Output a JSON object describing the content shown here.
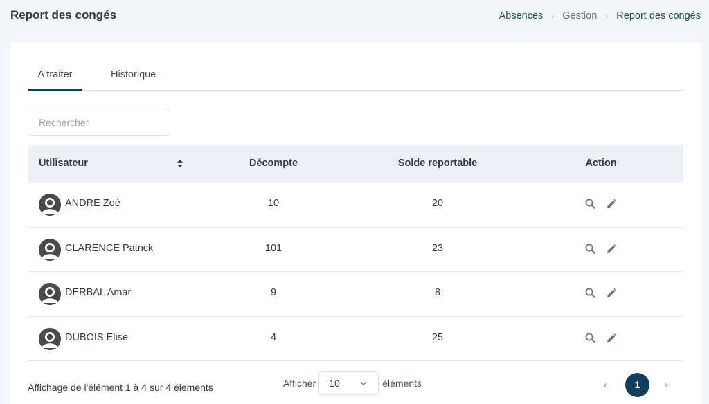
{
  "header": {
    "title": "Report des congés",
    "breadcrumb": [
      "Absences",
      "Gestion",
      "Report des congés"
    ]
  },
  "tabs": [
    {
      "label": "A traiter",
      "active": true
    },
    {
      "label": "Historique",
      "active": false
    }
  ],
  "search": {
    "placeholder": "Rechercher",
    "value": ""
  },
  "table": {
    "headers": [
      "Utilisateur",
      "Décompte",
      "Solde reportable",
      "Action"
    ],
    "rows": [
      {
        "user": "ANDRE Zoé",
        "decompte": "10",
        "solde": "20"
      },
      {
        "user": "CLARENCE Patrick",
        "decompte": "101",
        "solde": "23"
      },
      {
        "user": "DERBAL Amar",
        "decompte": "9",
        "solde": "8"
      },
      {
        "user": "DUBOIS Elise",
        "decompte": "4",
        "solde": "25"
      }
    ],
    "row_actions": [
      "search-icon",
      "pencil-icon"
    ]
  },
  "footer": {
    "info": "Affichage de l'élément 1 à 4 sur 4 élements",
    "length_prefix": "Afficher",
    "length_value": "10",
    "length_suffix": "éléments",
    "prev": "‹",
    "current_page": "1",
    "next": "›"
  },
  "colors": {
    "accent": "#123f5c",
    "link": "#1b4f72",
    "background": "#f4f5f8",
    "table_header": "#eceff4"
  }
}
